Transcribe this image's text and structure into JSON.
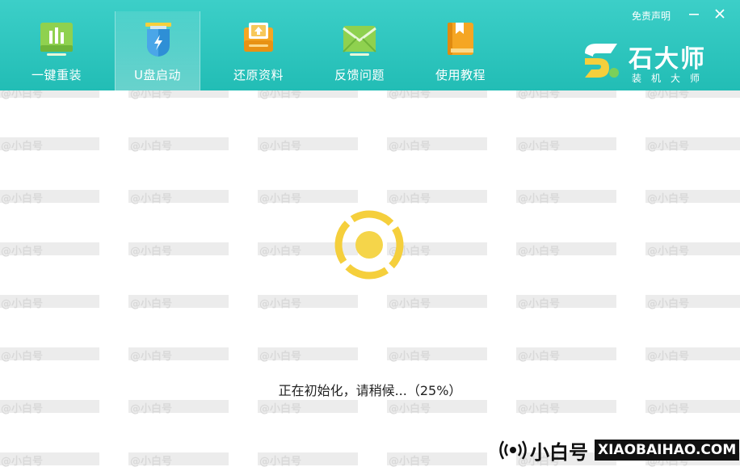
{
  "header": {
    "nav": [
      {
        "label": "一键重装",
        "icon": "bar-chart-icon",
        "active": false
      },
      {
        "label": "U盘启动",
        "icon": "usb-drive-icon",
        "active": true
      },
      {
        "label": "还原资料",
        "icon": "restore-folder-icon",
        "active": false
      },
      {
        "label": "反馈问题",
        "icon": "mail-feedback-icon",
        "active": false
      },
      {
        "label": "使用教程",
        "icon": "book-icon",
        "active": false
      }
    ],
    "disclaimer": "免责声明",
    "minimize_icon": "minimize-icon",
    "close_icon": "close-icon"
  },
  "brand": {
    "name": "石大师",
    "subtitle": "装机大师"
  },
  "main": {
    "status": "正在初始化，请稍候...（25%）",
    "progress_percent": 25,
    "spinner_icon": "loading-spinner-icon"
  },
  "watermark": {
    "cn": "@小白号",
    "en": "XIAOBAIHAO.COM",
    "corner_cn": "小白号",
    "corner_en": "XIAOBAIHAO.COM",
    "corner_icon": "broadcast-icon"
  },
  "colors": {
    "header": "#2cc4bd",
    "accent_yellow": "#f5cf3c",
    "text": "#222222"
  }
}
